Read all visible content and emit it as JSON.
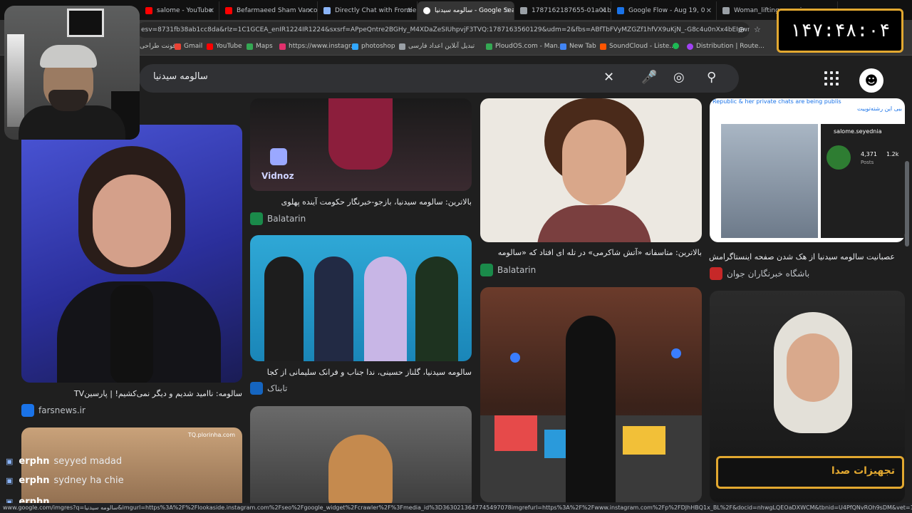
{
  "tabs": [
    {
      "label": "salome - YouTube",
      "color": "#ff0000"
    },
    {
      "label": "Befarmaeed Sham Vanco",
      "color": "#ff0000"
    },
    {
      "label": "Directly Chat with Frontie",
      "color": "#8ab4f8"
    },
    {
      "label": "سالومه سیدنیا - Google Search",
      "color": "#4285f4"
    },
    {
      "label": "1787162187655-01a01b",
      "color": "#9aa0a6"
    },
    {
      "label": "Google Flow - Aug 19, 0",
      "color": "#1a73e8"
    },
    {
      "label": "Woman_lifting_man_in",
      "color": "#9aa0a6"
    }
  ],
  "address": {
    "url": "esv=8731fb38ab1cc8da&rlz=1C1GCEA_enIR1224IR1224&sxsrf=APpeQntre2BGHy_M4XDaZeSIUhpvjF3TVQ:1787163560129&udm=2&fbs=ABfTbFVyMZGZf1hfVX9uKjN_-G8c4u0nXx4bEIpwm1InNH83..."
  },
  "bookmarks": [
    {
      "label": "فونت طراحی",
      "color": "#9aa0a6"
    },
    {
      "label": "Gmail",
      "color": "#ea4335"
    },
    {
      "label": "YouTube",
      "color": "#ff0000"
    },
    {
      "label": "Maps",
      "color": "#34a853"
    },
    {
      "label": "https://www.instagr...",
      "color": "#e1306c"
    },
    {
      "label": "photoshop",
      "color": "#31a8ff"
    },
    {
      "label": "تبدیل آنلاین اعداد فارسی",
      "color": "#9aa0a6"
    },
    {
      "label": "PloudOS.com - Man...",
      "color": "#34a853"
    },
    {
      "label": "New Tab",
      "color": "#4285f4"
    },
    {
      "label": "SoundCloud - Liste...",
      "color": "#ff5500"
    },
    {
      "label": "",
      "color": "#1db954"
    },
    {
      "label": "Distribution | Route...",
      "color": "#a142f4"
    }
  ],
  "search": {
    "query": "سالومه سیدنیا"
  },
  "clock": {
    "text": "۱۴۷:۴۸:۰۴"
  },
  "results": [
    {
      "caption": "بالاترین: سالومه سیدنیا، بازجو-خبرنگار حکومت آینده پهلوی",
      "source": "Balatarin",
      "color": "#1a8a4a"
    },
    {
      "caption": "بالاترین: متاسفانه «آتش شاکرمی» در تله ای افتاد که «سالومه",
      "source": "Balatarin",
      "color": "#1a8a4a"
    },
    {
      "caption": "عصبانیت سالومه سیدنیا از هک شدن صفحه اینستاگرامش",
      "source": "باشگاه خبرنگاران جوان",
      "color": "#c62828"
    },
    {
      "caption": "سالومه سیدنیا، گلناز حسینی، ندا جناب و فرانک سلیمانی از کجا",
      "source": "تابناک",
      "color": "#1565c0"
    },
    {
      "caption": "سالومه: ناامید شدیم و دیگر نمی‌کشیم! | پارسینTV",
      "source": "farsnews.ir",
      "color": "#1a73e8"
    }
  ],
  "image_text": {
    "vidnoz": "Vidnoz",
    "insta_header": "Republic & her private chats are being publis",
    "insta_header2": "ببی این رشته‌توییت",
    "insta_user": "salome.seyednia",
    "insta_posts": "4,371",
    "insta_followers": "1.2k",
    "insta_posts_label": "Posts",
    "watermark": "TQ.plorinha.com"
  },
  "chat": [
    {
      "user": "erphn",
      "msg": "seyyed madad"
    },
    {
      "user": "erphn",
      "msg": "sydney ha chie"
    },
    {
      "user": "erphn",
      "msg": ""
    }
  ],
  "banner": {
    "label": "تجهیزات صدا"
  },
  "status": {
    "text": "www.google.com/imgres?q=سالومه سیدنیا&imgurl=https%3A%2F%2Flookaside.instagram.com%2Fseo%2Fgoogle_widget%2Fcrawler%2F%3Fmedia_id%3D3630213647745497078imgrefurl=https%3A%2F%2Fwww.instagram.com%2Fp%2FDJhHBQ1x_BL%2F&docid=nhwgLQEOaDXWCM&tbnid=U4PfQNvROh9sDM&vet=12ahUKEwjKt0Yp6WZWA..."
  }
}
